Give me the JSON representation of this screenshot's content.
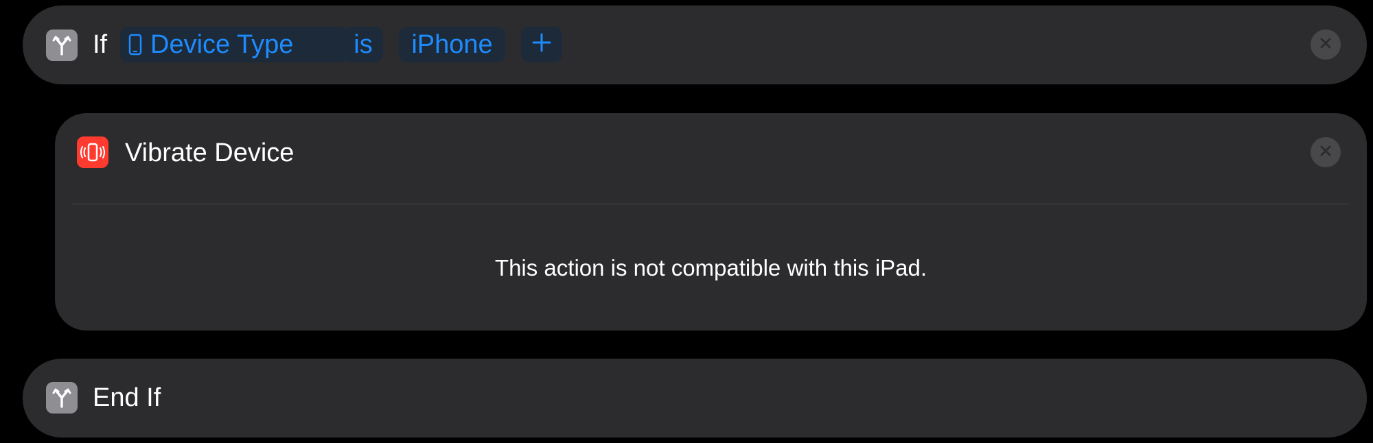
{
  "if_block": {
    "keyword": "If",
    "icon": "branch-icon",
    "variable_label": "Device Type",
    "variable_icon": "iphone-outline-icon",
    "operator": "is",
    "value": "iPhone",
    "add_label": "+"
  },
  "vibrate_action": {
    "title": "Vibrate Device",
    "icon": "vibrating-phone-icon",
    "message": "This action is not compatible with this iPad."
  },
  "end_if_block": {
    "title": "End If",
    "icon": "branch-icon"
  },
  "colors": {
    "background": "#000000",
    "card": "#2c2c2e",
    "token_text": "#1e8cff",
    "token_bg": "#1c2a3a",
    "control_icon": "#8e8e93",
    "vibrate_icon": "#ff3b30"
  }
}
